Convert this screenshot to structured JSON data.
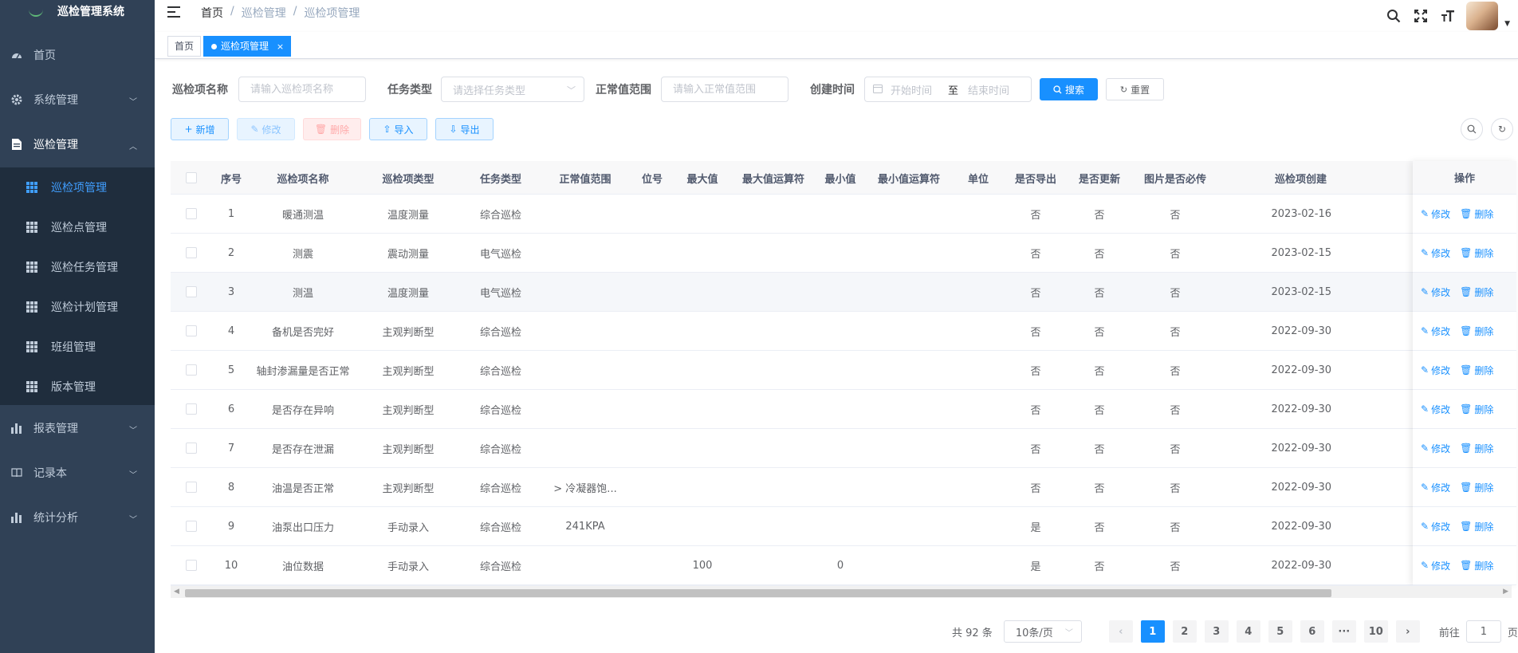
{
  "app": {
    "title": "巡检管理系统"
  },
  "sidebar": {
    "menu": [
      {
        "label": "首页",
        "icon": "dashboard-icon"
      },
      {
        "label": "系统管理",
        "icon": "gear-icon"
      },
      {
        "label": "巡检管理",
        "icon": "document-icon"
      },
      {
        "label": "报表管理",
        "icon": "bar-chart-icon"
      },
      {
        "label": "记录本",
        "icon": "book-icon"
      },
      {
        "label": "统计分析",
        "icon": "bar-chart-icon"
      }
    ],
    "submenu": [
      {
        "label": "巡检项管理",
        "active": true
      },
      {
        "label": "巡检点管理"
      },
      {
        "label": "巡检任务管理"
      },
      {
        "label": "巡检计划管理"
      },
      {
        "label": "班组管理"
      },
      {
        "label": "版本管理"
      }
    ]
  },
  "header": {
    "breadcrumb": [
      "首页",
      "/",
      "巡检管理",
      "/",
      "巡检项管理"
    ]
  },
  "tags": [
    {
      "label": "首页"
    },
    {
      "label": "巡检项管理",
      "close": "×"
    }
  ],
  "search": {
    "name_label": "巡检项名称",
    "name_placeholder": "请输入巡检项名称",
    "task_type_label": "任务类型",
    "task_type_placeholder": "请选择任务类型",
    "range_label": "正常值范围",
    "range_placeholder": "请输入正常值范围",
    "created_label": "创建时间",
    "start_placeholder": "开始时间",
    "range_sep": "至",
    "end_placeholder": "结束时间",
    "search_button": "搜索",
    "reset_button": "重置"
  },
  "toolbar": {
    "add": "新增",
    "edit": "修改",
    "delete": "删除",
    "import": "导入",
    "export": "导出"
  },
  "table": {
    "headers": [
      "序号",
      "巡检项名称",
      "巡检项类型",
      "任务类型",
      "正常值范围",
      "位号",
      "最大值",
      "最大值运算符",
      "最小值",
      "最小值运算符",
      "单位",
      "是否导出",
      "是否更新",
      "图片是否必传",
      "巡检项创建",
      "操作"
    ],
    "rows": [
      [
        "1",
        "暖通测温",
        "温度测量",
        "综合巡检",
        "",
        "",
        "",
        "",
        "",
        "",
        "",
        "否",
        "否",
        "否",
        "2023-02-16"
      ],
      [
        "2",
        "测震",
        "震动测量",
        "电气巡检",
        "",
        "",
        "",
        "",
        "",
        "",
        "",
        "否",
        "否",
        "否",
        "2023-02-15"
      ],
      [
        "3",
        "测温",
        "温度测量",
        "电气巡检",
        "",
        "",
        "",
        "",
        "",
        "",
        "",
        "否",
        "否",
        "否",
        "2023-02-15"
      ],
      [
        "4",
        "备机是否完好",
        "主观判断型",
        "综合巡检",
        "",
        "",
        "",
        "",
        "",
        "",
        "",
        "否",
        "否",
        "否",
        "2022-09-30"
      ],
      [
        "5",
        "轴封渗漏量是否正常",
        "主观判断型",
        "综合巡检",
        "",
        "",
        "",
        "",
        "",
        "",
        "",
        "否",
        "否",
        "否",
        "2022-09-30"
      ],
      [
        "6",
        "是否存在异响",
        "主观判断型",
        "综合巡检",
        "",
        "",
        "",
        "",
        "",
        "",
        "",
        "否",
        "否",
        "否",
        "2022-09-30"
      ],
      [
        "7",
        "是否存在泄漏",
        "主观判断型",
        "综合巡检",
        "",
        "",
        "",
        "",
        "",
        "",
        "",
        "否",
        "否",
        "否",
        "2022-09-30"
      ],
      [
        "8",
        "油温是否正常",
        "主观判断型",
        "综合巡检",
        "> 冷凝器饱...",
        "",
        "",
        "",
        "",
        "",
        "",
        "否",
        "否",
        "否",
        "2022-09-30"
      ],
      [
        "9",
        "油泵出口压力",
        "手动录入",
        "综合巡检",
        "241KPA",
        "",
        "",
        "",
        "",
        "",
        "",
        "是",
        "否",
        "否",
        "2022-09-30"
      ],
      [
        "10",
        "油位数据",
        "手动录入",
        "综合巡检",
        "",
        "",
        "100",
        "",
        "0",
        "",
        "",
        "是",
        "否",
        "否",
        "2022-09-30"
      ]
    ],
    "op_edit": "修改",
    "op_delete": "删除"
  },
  "pagination": {
    "total": "共 92 条",
    "page_size": "10条/页",
    "pages": [
      "1",
      "2",
      "3",
      "4",
      "5",
      "6",
      "···",
      "10"
    ],
    "current": "1",
    "goto_prefix": "前往",
    "goto_value": "1",
    "goto_suffix": "页"
  },
  "colors": {
    "primary": "#1890ff",
    "sidebar": "#304156",
    "submenu": "#1f2d3d"
  }
}
